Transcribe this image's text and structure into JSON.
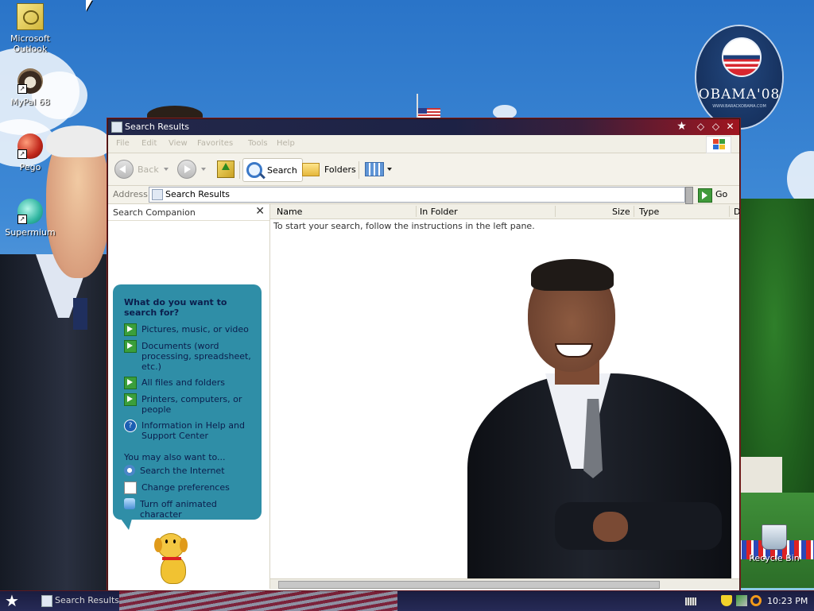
{
  "desktop": {
    "icons": [
      {
        "label": "Microsoft Outlook"
      },
      {
        "label": "MyPal 68"
      },
      {
        "label": "Pego"
      },
      {
        "label": "Supermium"
      },
      {
        "label": "Recycle Bin"
      }
    ],
    "wallpaper_logo": {
      "text": "OBAMA'08",
      "url": "WWW.BARACKOBAMA.COM"
    }
  },
  "window": {
    "title": "Search Results",
    "menu": [
      "File",
      "Edit",
      "View",
      "Favorites",
      "Tools",
      "Help"
    ],
    "toolbar": {
      "back_label": "Back",
      "search_label": "Search",
      "folders_label": "Folders"
    },
    "address": {
      "label": "Address",
      "value": "Search Results",
      "go_label": "Go"
    },
    "search_companion": {
      "title": "Search Companion",
      "close_glyph": "✕",
      "question": "What do you want to search for?",
      "options": [
        {
          "label": "Pictures, music, or video"
        },
        {
          "label": "Documents (word processing, spreadsheet, etc.)"
        },
        {
          "label": "All files and folders"
        },
        {
          "label": "Printers, computers, or people"
        },
        {
          "label": "Information in Help and Support Center"
        }
      ],
      "also_label": "You may also want to...",
      "also_options": [
        {
          "label": "Search the Internet"
        },
        {
          "label": "Change preferences"
        },
        {
          "label": "Turn off animated character"
        }
      ]
    },
    "results": {
      "columns": [
        "Name",
        "In Folder",
        "Size",
        "Type",
        "D"
      ],
      "empty_message": "To start your search, follow the instructions in the left pane."
    }
  },
  "taskbar": {
    "task_label": "Search Results",
    "clock": "10:23 PM"
  },
  "colors": {
    "titlebar_start": "#23284a",
    "titlebar_end": "#a0151f",
    "companion_bubble": "#2f8ea7"
  }
}
